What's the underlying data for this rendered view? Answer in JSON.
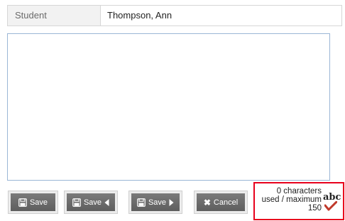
{
  "student": {
    "label": "Student",
    "value": "Thompson, Ann"
  },
  "comment": {
    "value": ""
  },
  "buttons": {
    "save": "Save",
    "save_prev": "Save",
    "save_next": "Save",
    "cancel": "Cancel"
  },
  "counter": {
    "text": "0 characters used / maximum 150",
    "used": 0,
    "maximum": 150
  },
  "spellcheck": {
    "label": "abc"
  },
  "colors": {
    "button_bg": "#6b6b6b",
    "highlight_border": "#e8001c",
    "check_mark": "#c0392b"
  },
  "icons": {
    "save": "floppy-disk-icon",
    "prev": "arrow-left-icon",
    "next": "arrow-right-icon",
    "cancel": "x-icon",
    "spellcheck": "spellcheck-icon"
  }
}
